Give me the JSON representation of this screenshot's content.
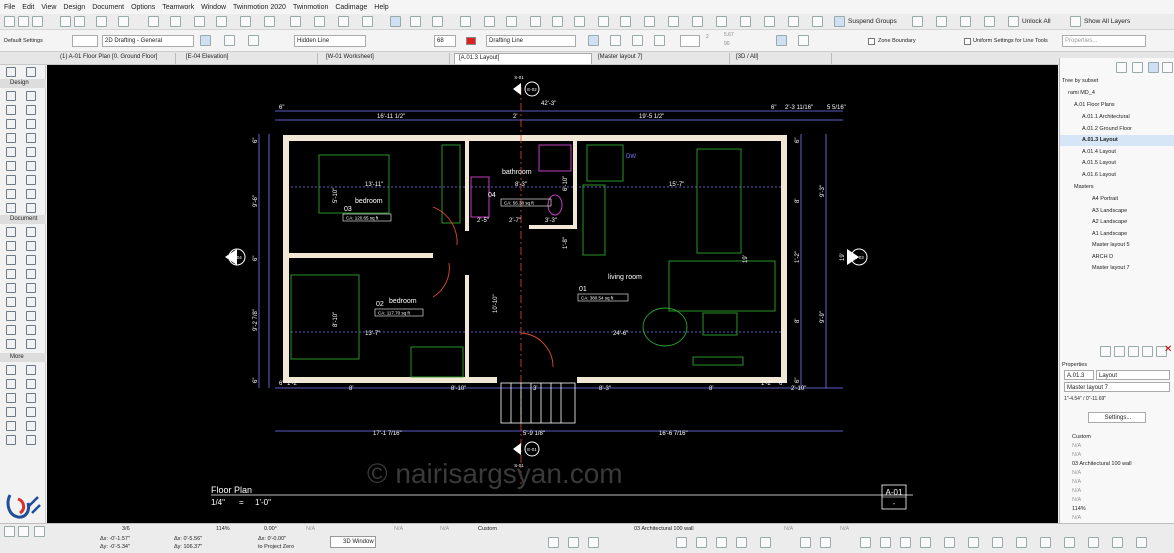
{
  "menu": [
    "File",
    "Edit",
    "View",
    "Design",
    "Document",
    "Options",
    "Teamwork",
    "Window",
    "Twinmotion 2020",
    "Twinmotion",
    "Cadimage",
    "Help"
  ],
  "toolbar_top": {
    "suspend_groups": "Suspend Groups",
    "unlock_all": "Unlock All",
    "show_all_layers": "Show All Layers"
  },
  "info_box": {
    "default_settings": "Default Settings",
    "drafting_set": "2D Drafting - General",
    "line_type": "Hidden Line",
    "pen_number": "68",
    "line_category": "Drafting Line",
    "dim_a": "2",
    "dim_b": "5.67",
    "dim_c": "90",
    "zone_boundary": "Zone Boundary",
    "uniform_settings": "Uniform Settings for Line Tools",
    "properties_btn": "Properties..."
  },
  "tabs": [
    "(1) A-01 Floor Plan [0. Ground Floor]",
    "[E-04 Elevation]",
    "[W-01 Worksheet]",
    "[A.01.3 Layout]",
    "[Master layout 7]",
    "[3D / All]"
  ],
  "palette": {
    "arrow": "▸",
    "sections": [
      "Design",
      "Document",
      "More"
    ]
  },
  "drawing": {
    "dims_top": [
      "6\"",
      "16'-11 1/2\"",
      "2'",
      "19'-5 1/2\"",
      "6\"",
      "2'-3 11/16\"",
      "5 5/16\"",
      "42'-3\""
    ],
    "dims_bottom": [
      "6\"",
      "1'-2\"",
      "8'",
      "8'-10\"",
      "3'",
      "8'-3\"",
      "8'",
      "1'-2\"",
      "6\"",
      "2'-10\"",
      "17'-1 7/16\"",
      "5'-9 1/8\"",
      "16'-6 7/16\""
    ],
    "dims_left": [
      "6\"",
      "9'-6\"",
      "6\"",
      "9'-2 7/8\"",
      "6\""
    ],
    "dims_right": [
      "6\"",
      "8'",
      "9'-3\"",
      "1'-2\"",
      "19'",
      "9'-9\"",
      "8'",
      "6\""
    ],
    "interior_dims": [
      "13'-11\"",
      "5'-10\"",
      "8'-3\"",
      "6'-10\"",
      "15'-7\"",
      "2'-5\"",
      "2'-7\"",
      "3'-3\"",
      "1'-8\"",
      "10'-10\"",
      "8'-10\"",
      "13'-7\"",
      "24'-6\"",
      "19'"
    ],
    "rooms": [
      {
        "num": "03",
        "name": "bedroom",
        "area": "CA: 120.65 sq ft"
      },
      {
        "num": "04",
        "name": "bathroom",
        "area": "CA: 56.38 sq ft"
      },
      {
        "num": "01",
        "name": "living room",
        "area": "CA: 380.54 sq ft"
      },
      {
        "num": "02",
        "name": "bedroom",
        "area": "CA: 117.70 sq ft"
      }
    ],
    "markers": {
      "section_top_label": "S-01",
      "section_top_id": "E-02",
      "section_bottom_label": "S-01",
      "section_bottom_id": "E-01",
      "left_id": "E-04",
      "right_id": "E-03"
    },
    "appliance": "DW",
    "watermark": "© nairisargsyan.com",
    "title": "Floor Plan",
    "scale_left": "1/4\"",
    "scale_eq": "=",
    "scale_right": "1'-0\"",
    "sheet_id": "A-01",
    "sheet_sub": "-"
  },
  "right_panel": {
    "header": "Tree by subset",
    "project": "rami MD_4",
    "folder": "A.01 Floor Plans",
    "layouts": [
      "A.01.1 Architectural",
      "A.01.2 Ground Floor",
      "A.01.3 Layout",
      "A.01.4 Layout",
      "A.01.5 Layout",
      "A.01.6 Layout"
    ],
    "masters_label": "Masters",
    "masters": [
      "A4 Portrait",
      "A3 Landscape",
      "A2 Landscape",
      "A1 Landscape",
      "Master layout 5",
      "ARCH D",
      "Master layout 7"
    ],
    "properties_label": "Properties",
    "prop_id": "A.01.3",
    "prop_name": "Layout",
    "prop_master": "Master layout 7",
    "prop_size": "1\"-4.54\" / 0\"-11.69\"",
    "settings_btn": "Settings...",
    "custom": "Custom",
    "na": "N/A",
    "pen_set": "03 Architectural 100 wall",
    "zoom_pct": "114%"
  },
  "status": {
    "page": "3/6",
    "zoom": "114%",
    "angle": "0.00°",
    "coords_1": "Δx: -0'-1.57\"",
    "coords_2": "Δy: -0'-5.34\"",
    "coords_3": "Δx: 0'-5.56\"",
    "coords_4": "Δy: 106.37\"",
    "coords_5": "Δx: 0'-0.00\"",
    "to_project_zero": "to Project Zero",
    "window_3d": "3D Window",
    "na": "N/A",
    "custom": "Custom",
    "pen_set": "03 Architectural 100 wall"
  },
  "colors": {
    "wall": "#f2e6d4",
    "dim": "#8080ff",
    "furniture": "#2ea52e",
    "bath": "#c040c0",
    "door": "#e34a2b"
  }
}
